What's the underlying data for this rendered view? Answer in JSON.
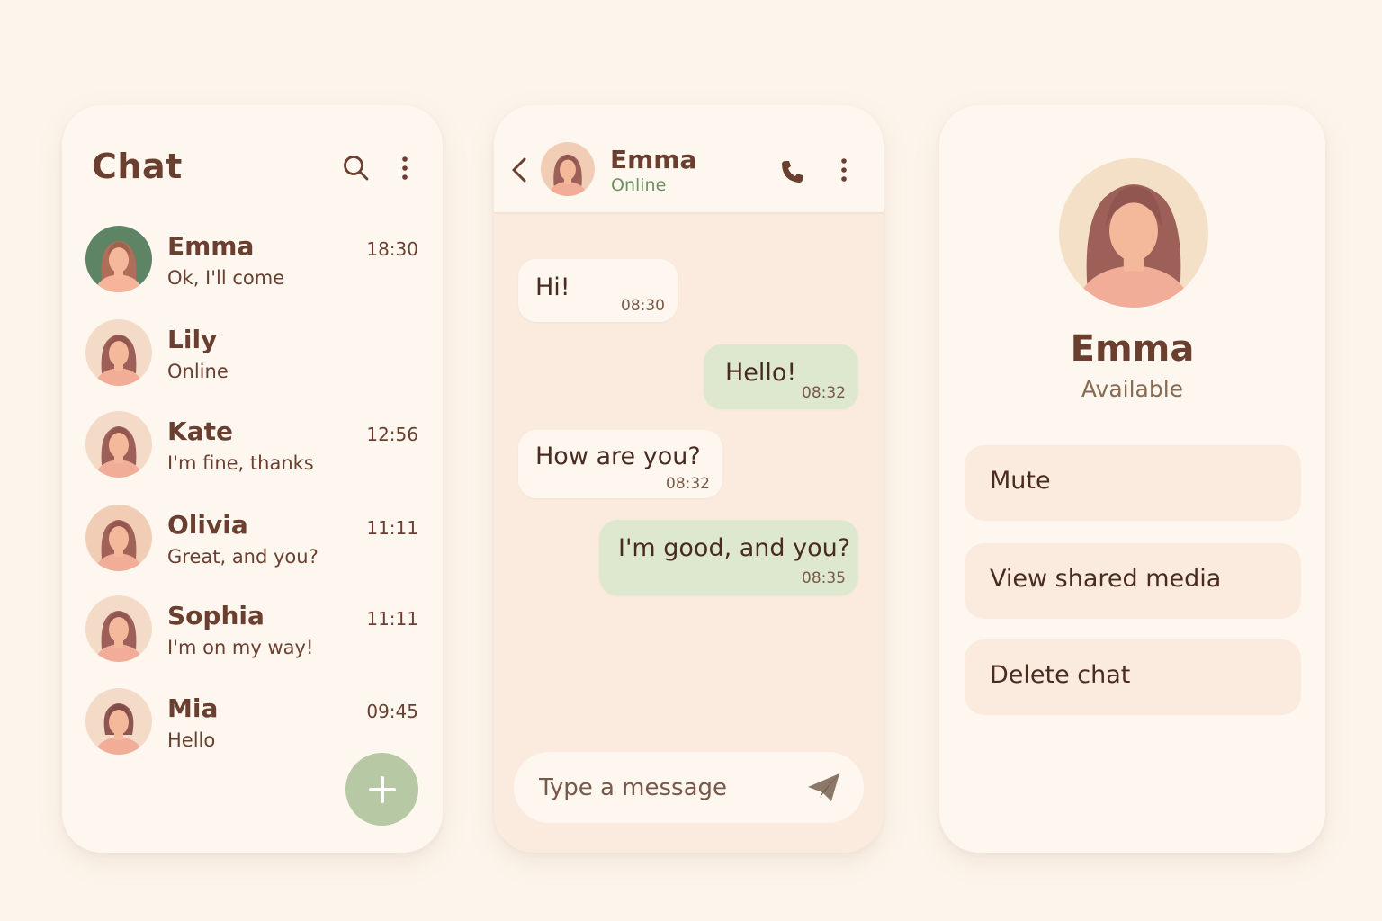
{
  "colors": {
    "background": "#fdf5ec",
    "card": "#fdf7f0",
    "accent_green": "#b7c8a5",
    "bubble_out": "#dde8cf",
    "text_brown": "#6b3f30",
    "online_green": "#6e9160"
  },
  "list": {
    "title": "Chat",
    "icons": [
      "search-icon",
      "more-vertical-icon"
    ],
    "contacts": [
      {
        "name": "Emma",
        "message": "Ok, I'll come",
        "time": "18:30",
        "avatar": "avatar-green"
      },
      {
        "name": "Lily",
        "message": "Online",
        "time": "",
        "avatar": "avatar-peach"
      },
      {
        "name": "Kate",
        "message": "I'm fine, thanks",
        "time": "12:56",
        "avatar": "avatar-peach"
      },
      {
        "name": "Olivia",
        "message": "Great, and you?",
        "time": "11:11",
        "avatar": "avatar-peach"
      },
      {
        "name": "Sophia",
        "message": "I'm on my way!",
        "time": "11:11",
        "avatar": "avatar-peach"
      },
      {
        "name": "Mia",
        "message": "Hello",
        "time": "09:45",
        "avatar": "avatar-peach"
      }
    ],
    "fab_icon": "plus-icon"
  },
  "chat": {
    "contact_name": "Emma",
    "contact_status": "Online",
    "icons": [
      "back-icon",
      "phone-icon",
      "more-vertical-icon",
      "send-icon"
    ],
    "messages": [
      {
        "text": "Hi!",
        "time": "08:30",
        "direction": "in"
      },
      {
        "text": "Hello!",
        "time": "08:32",
        "direction": "out"
      },
      {
        "text": "How are you?",
        "time": "08:32",
        "direction": "in"
      },
      {
        "text": "I'm good, and you?",
        "time": "08:35",
        "direction": "out"
      }
    ],
    "composer_placeholder": "Type a message"
  },
  "profile": {
    "name": "Emma",
    "status": "Available",
    "actions": [
      {
        "label": "Mute"
      },
      {
        "label": "View shared media"
      },
      {
        "label": "Delete chat"
      }
    ]
  }
}
